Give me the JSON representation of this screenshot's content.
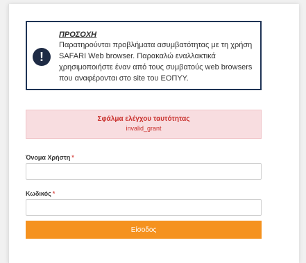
{
  "warning": {
    "title": "ΠΡΟΣΟΧΗ",
    "body": "Παρατηρούνται προβλήματα ασυμβατότητας με τη χρήση SAFARI Web browser. Παρακαλώ εναλλακτικά χρησιμοποιήστε έναν από τους συμβατούς web browsers που αναφέρονται στο site του ΕΟΠΥΥ.",
    "icon": "exclamation-circle-icon"
  },
  "error": {
    "title": "Σφάλμα ελέγχου ταυτότητας",
    "detail": "invalid_grant"
  },
  "form": {
    "username_label": "Όνομα Χρήστη",
    "password_label": "Κωδικός",
    "required_mark": "*",
    "username_value": "",
    "password_value": "",
    "submit_label": "Είσοδος"
  },
  "colors": {
    "warning_border": "#1e3355",
    "error_bg": "#f8dde0",
    "error_text": "#c9302c",
    "submit_bg": "#f5921f"
  }
}
